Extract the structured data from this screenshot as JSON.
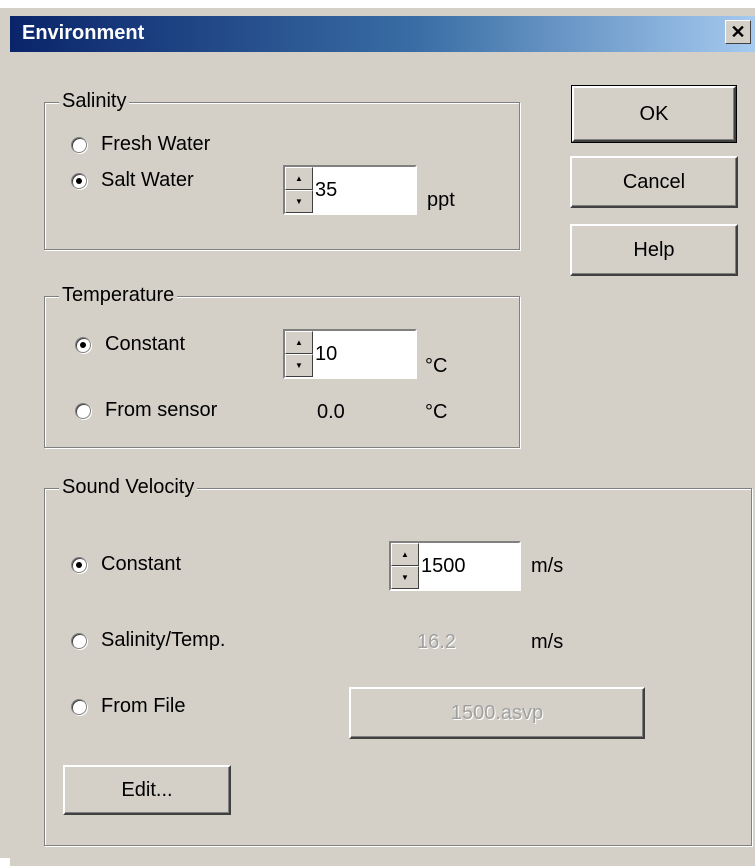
{
  "window": {
    "title": "Environment",
    "close_glyph": "✕"
  },
  "buttons": {
    "ok": "OK",
    "cancel": "Cancel",
    "help": "Help",
    "edit": "Edit..."
  },
  "salinity": {
    "label": "Salinity",
    "fresh_label": "Fresh Water",
    "salt_label": "Salt Water",
    "selected": "salt",
    "value": "35",
    "unit": "ppt"
  },
  "temperature": {
    "label": "Temperature",
    "constant_label": "Constant",
    "sensor_label": "From sensor",
    "selected": "constant",
    "value": "10",
    "unit": "°C",
    "sensor_value": "0.0",
    "sensor_unit": "°C"
  },
  "sound_velocity": {
    "label": "Sound Velocity",
    "constant_label": "Constant",
    "salinity_temp_label": "Salinity/Temp.",
    "file_label": "From File",
    "selected": "constant",
    "value": "1500",
    "unit": "m/s",
    "computed_value": "16.2",
    "computed_unit": "m/s",
    "file_button": "1500.asvp"
  },
  "icons": {
    "spin_up": "up-arrow-icon",
    "spin_down": "down-arrow-icon",
    "close": "close-icon"
  }
}
